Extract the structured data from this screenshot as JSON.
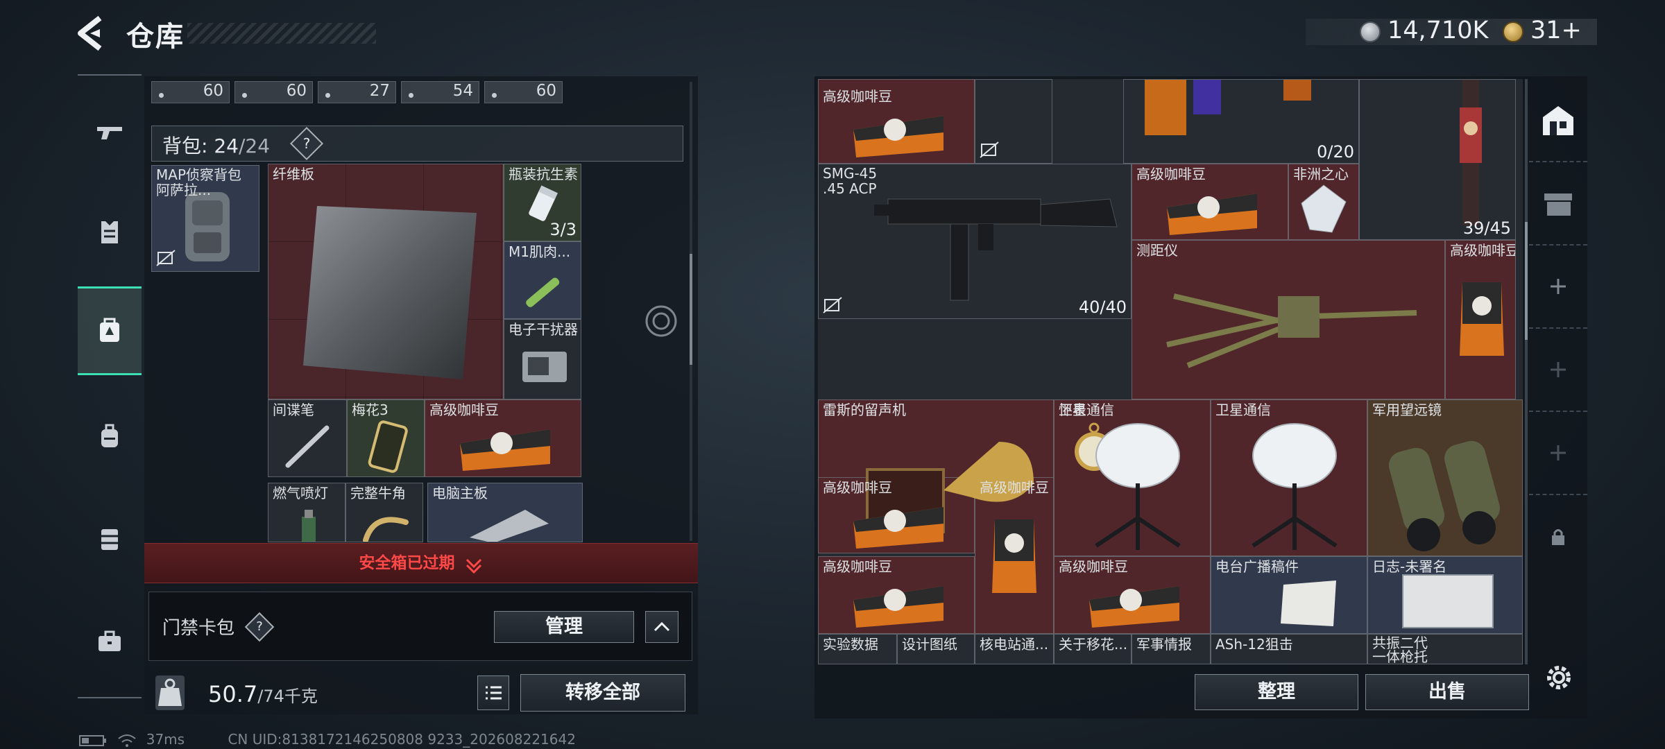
{
  "header": {
    "title": "仓库",
    "currency": [
      {
        "icon": "silver-coin-icon",
        "value": "14,710K"
      },
      {
        "icon": "gold-coin-icon",
        "value": "31+"
      }
    ]
  },
  "side_nav": [
    {
      "icon": "gun-icon",
      "name": "weapons"
    },
    {
      "icon": "armor-icon",
      "name": "armor"
    },
    {
      "icon": "backpack-safe-icon",
      "name": "loadout",
      "active": true
    },
    {
      "icon": "backpack-icon",
      "name": "backpack"
    },
    {
      "icon": "chest-rig-icon",
      "name": "chest-rig"
    },
    {
      "icon": "briefcase-icon",
      "name": "case"
    }
  ],
  "left": {
    "ammo": [
      "60",
      "60",
      "27",
      "54",
      "60"
    ],
    "backpack_label": "背包:",
    "backpack_count": "24",
    "backpack_max": "/24",
    "help": "?",
    "items": [
      {
        "name": "MAP侦察背包\n阿萨拉...",
        "count": ""
      },
      {
        "name": "纤维板",
        "count": ""
      },
      {
        "name": "瓶装抗生素",
        "count": "3/3"
      },
      {
        "name": "M1肌肉...",
        "count": ""
      },
      {
        "name": "电子干扰器",
        "count": ""
      },
      {
        "name": "间谍笔",
        "count": ""
      },
      {
        "name": "梅花3",
        "count": ""
      },
      {
        "name": "高级咖啡豆",
        "count": ""
      },
      {
        "name": "燃气喷灯",
        "count": ""
      },
      {
        "name": "完整牛角",
        "count": ""
      },
      {
        "name": "电脑主板",
        "count": ""
      }
    ],
    "safe_box": "安全箱已过期",
    "card_pack": "门禁卡包",
    "manage": "管理",
    "weight_value": "50.7",
    "weight_max": "/74千克",
    "transfer_all": "转移全部"
  },
  "right": {
    "items": [
      {
        "name": "高级咖啡豆",
        "count": ""
      },
      {
        "name": "",
        "count": "0/20"
      },
      {
        "name": "SMG-45\n.45 ACP",
        "count": "40/40"
      },
      {
        "name": "高级咖啡豆",
        "count": ""
      },
      {
        "name": "非洲之心",
        "count": ""
      },
      {
        "name": "",
        "count": "39/45"
      },
      {
        "name": "测距仪",
        "count": ""
      },
      {
        "name": "高级咖啡豆",
        "count": ""
      },
      {
        "name": "雷斯的留声机",
        "count": ""
      },
      {
        "name": "怀表",
        "count": ""
      },
      {
        "name": "卫星通信",
        "count": ""
      },
      {
        "name": "卫星通信",
        "count": ""
      },
      {
        "name": "军用望远镜",
        "count": ""
      },
      {
        "name": "高级咖啡豆",
        "count": ""
      },
      {
        "name": "高级咖啡豆",
        "count": ""
      },
      {
        "name": "高级咖啡豆",
        "count": ""
      },
      {
        "name": "高级咖啡豆",
        "count": ""
      },
      {
        "name": "电台广播稿件",
        "count": ""
      },
      {
        "name": "日志-未署名",
        "count": ""
      },
      {
        "name": "实验数据",
        "count": ""
      },
      {
        "name": "设计图纸",
        "count": ""
      },
      {
        "name": "核电站通...",
        "count": ""
      },
      {
        "name": "关于移花...",
        "count": ""
      },
      {
        "name": "军事情报",
        "count": ""
      },
      {
        "name": "ASh-12狙击",
        "count": ""
      },
      {
        "name": "共振二代\n一体枪托",
        "count": ""
      }
    ],
    "sort": "整理",
    "sell": "出售"
  },
  "status": {
    "ping": "37ms",
    "uid": "CN UID:8138172146250808 9233_202608221642"
  }
}
